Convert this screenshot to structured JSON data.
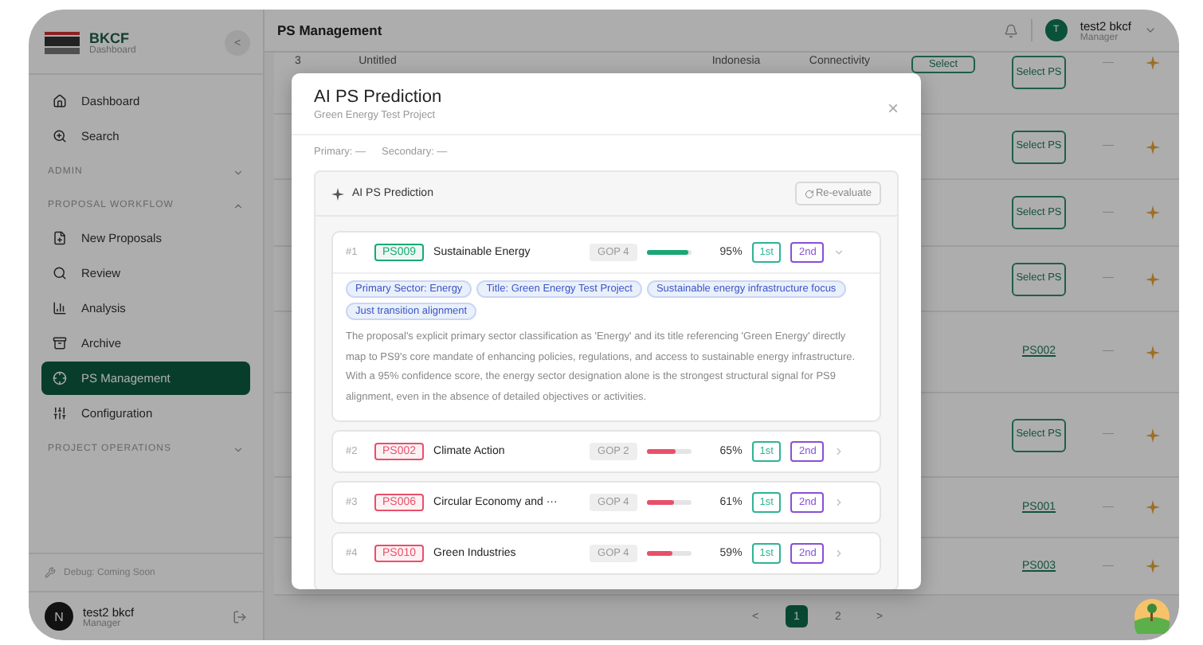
{
  "sidebar": {
    "brand": "BKCF",
    "brand_sub": "Dashboard",
    "collapse": "<",
    "items": [
      {
        "kind": "link",
        "label": "Dashboard",
        "selected": false
      },
      {
        "kind": "link",
        "label": "Search",
        "selected": false
      },
      {
        "kind": "section",
        "label": "ADMIN",
        "expanded": false
      },
      {
        "kind": "section",
        "label": "PROPOSAL WORKFLOW",
        "expanded": true
      },
      {
        "kind": "link",
        "label": "New Proposals",
        "selected": false
      },
      {
        "kind": "link",
        "label": "Review",
        "selected": false
      },
      {
        "kind": "link",
        "label": "Analysis",
        "selected": false
      },
      {
        "kind": "link",
        "label": "Archive",
        "selected": false
      },
      {
        "kind": "link",
        "label": "PS Management",
        "selected": true
      },
      {
        "kind": "link",
        "label": "Configuration",
        "selected": false
      },
      {
        "kind": "section",
        "label": "PROJECT OPERATIONS",
        "expanded": false
      }
    ],
    "debug": "Debug: Coming Soon",
    "user": {
      "initial": "N",
      "name": "test2 bkcf",
      "role": "Manager"
    }
  },
  "header": {
    "title": "PS Management",
    "user": {
      "initial": "T",
      "name": "test2 bkcf",
      "role": "Manager"
    }
  },
  "table": {
    "rows": [
      {
        "number": "3",
        "title": "Untitled",
        "country": "Indonesia",
        "sector": "Connectivity",
        "action": "Select",
        "ps": {
          "kind": "button",
          "label": "Select PS"
        },
        "score": "—"
      },
      {
        "ps": {
          "kind": "button",
          "label": "Select PS"
        },
        "score": "—"
      },
      {
        "ps": {
          "kind": "button",
          "label": "Select PS"
        },
        "score": "—"
      },
      {
        "ps": {
          "kind": "button",
          "label": "Select PS"
        },
        "score": "—"
      },
      {
        "ps": {
          "kind": "link",
          "label": "PS002"
        },
        "score": "—"
      },
      {
        "ps": {
          "kind": "button",
          "label": "Select PS"
        },
        "score": "—"
      },
      {
        "ps": {
          "kind": "link",
          "label": "PS001"
        },
        "score": "—"
      },
      {
        "ps": {
          "kind": "link",
          "label": "PS003"
        },
        "score": "—"
      }
    ]
  },
  "pagination": [
    {
      "label": "<",
      "selected": false
    },
    {
      "label": "1",
      "selected": true
    },
    {
      "label": "2",
      "selected": false
    },
    {
      "label": ">",
      "selected": false
    }
  ],
  "modal": {
    "title": "AI PS Prediction",
    "subtitle": "Green Energy Test Project",
    "close": "×",
    "primary": "Primary: —",
    "secondary": "Secondary: —",
    "panel": {
      "title": "AI PS Prediction",
      "reevaluate": "Re-evaluate",
      "predictions": [
        {
          "rank": "#1",
          "code": "PS009",
          "name": "Sustainable Energy",
          "gop": "GOP 4",
          "level": 0.95,
          "percent": "95%",
          "color": "#1aa774",
          "first": "1st",
          "second": "2nd",
          "expanded": true,
          "tags": [
            "Primary Sector: Energy",
            "Title: Green Energy Test Project",
            "Sustainable energy infrastructure focus",
            "Just transition alignment"
          ],
          "explanation": "The proposal's explicit primary sector classification as 'Energy' and its title referencing 'Green Energy' directly map to PS9's core mandate of enhancing policies, regulations, and access to sustainable energy infrastructure. With a 95% confidence score, the energy sector designation alone is the strongest structural signal for PS9 alignment, even in the absence of detailed objectives or activities."
        },
        {
          "rank": "#2",
          "code": "PS002",
          "name": "Climate Action",
          "gop": "GOP 2",
          "level": 0.65,
          "percent": "65%",
          "color": "#e8506a",
          "first": "1st",
          "second": "2nd",
          "expanded": false
        },
        {
          "rank": "#3",
          "code": "PS006",
          "name": "Circular Economy and ···",
          "gop": "GOP 4",
          "level": 0.61,
          "percent": "61%",
          "color": "#e8506a",
          "first": "1st",
          "second": "2nd",
          "expanded": false
        },
        {
          "rank": "#4",
          "code": "PS010",
          "name": "Green Industries",
          "gop": "GOP 4",
          "level": 0.59,
          "percent": "59%",
          "color": "#e8506a",
          "first": "1st",
          "second": "2nd",
          "expanded": false
        }
      ]
    }
  }
}
